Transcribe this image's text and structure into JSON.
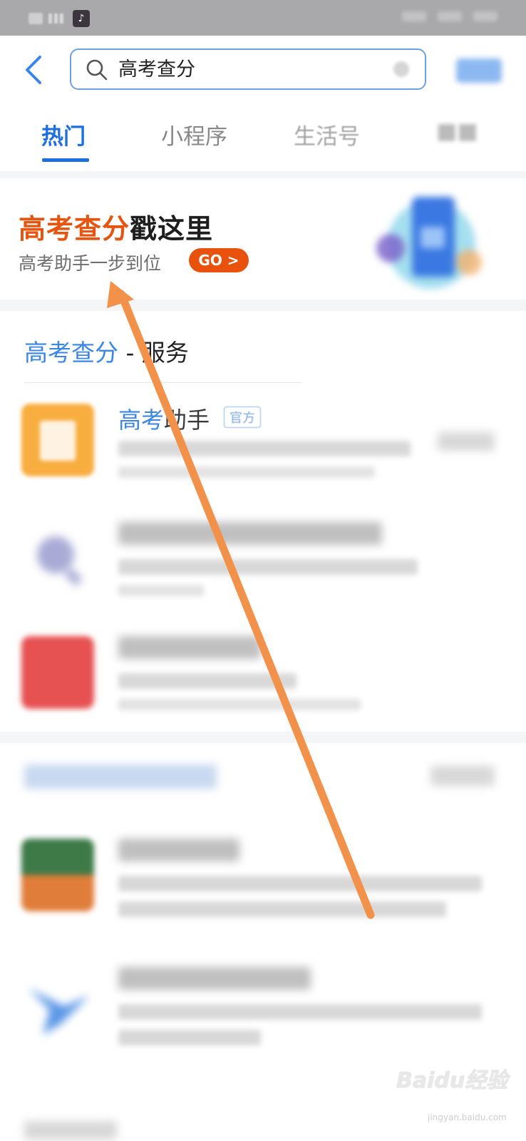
{
  "status_bar": {
    "app_icon": "tiktok-icon"
  },
  "search": {
    "query": "高考查分",
    "back_icon": "chevron-left-icon",
    "search_icon": "magnifier-icon"
  },
  "tabs": [
    {
      "label": "热门",
      "active": true
    },
    {
      "label": "小程序",
      "active": false
    },
    {
      "label": "生活号",
      "active": false
    }
  ],
  "banner": {
    "title_highlight": "高考查分",
    "title_rest": "戳这里",
    "subtitle": "高考助手一步到位",
    "go_label": "GO >"
  },
  "services": {
    "title_highlight": "高考查分",
    "title_rest": " - 服务",
    "items": [
      {
        "name_blue": "高考",
        "name_dark": "助手",
        "badge": "官方"
      }
    ]
  },
  "watermark": {
    "text": "Baidu经验",
    "url": "jingyan.baidu.com"
  },
  "colors": {
    "accent_blue": "#1b6fe0",
    "accent_orange": "#e6540f",
    "annotation_arrow": "#f2914a"
  }
}
